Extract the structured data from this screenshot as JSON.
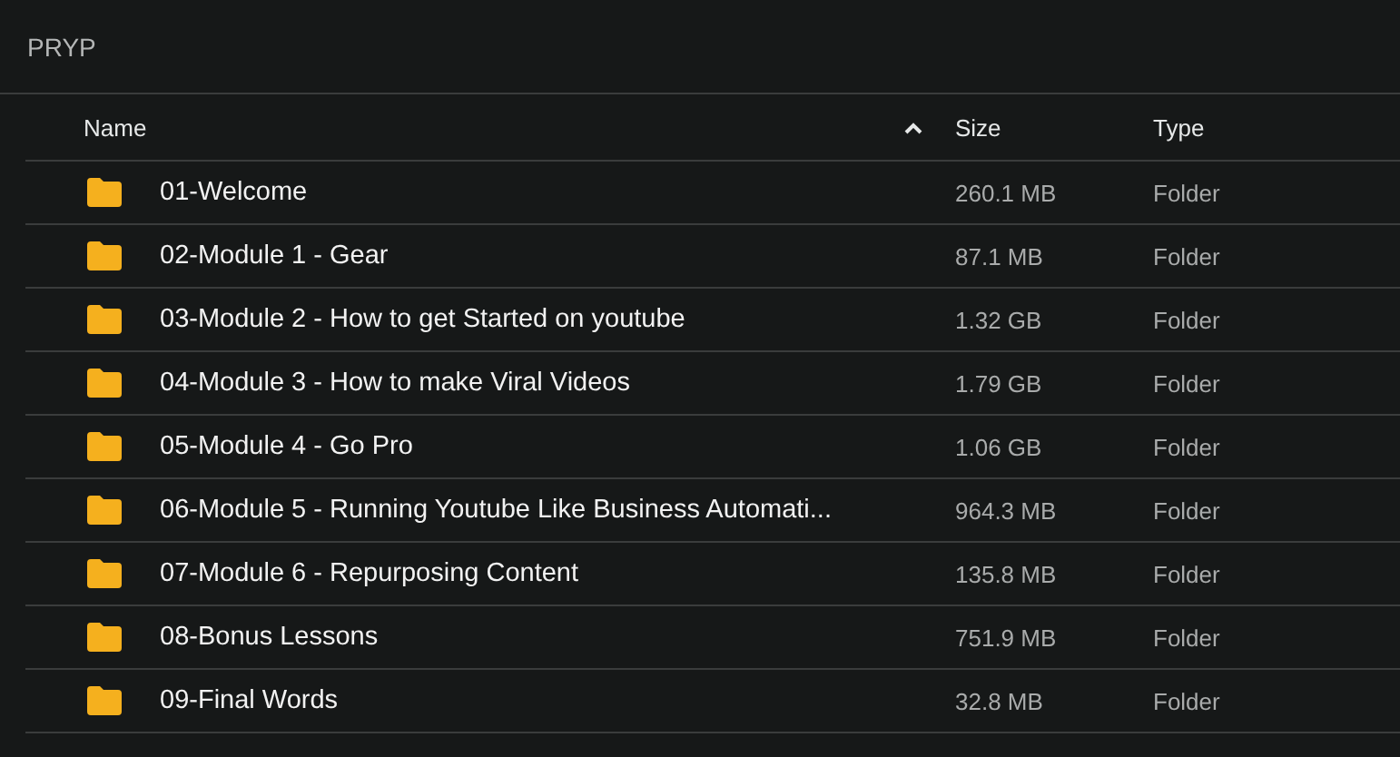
{
  "title": "PRYP",
  "columns": [
    {
      "label": "Name",
      "sorted_ascending": true
    },
    {
      "label": "Size"
    },
    {
      "label": "Type"
    }
  ],
  "rows": [
    {
      "name": "01-Welcome",
      "size": "260.1 MB",
      "type": "Folder"
    },
    {
      "name": "02-Module 1 - Gear",
      "size": "87.1 MB",
      "type": "Folder"
    },
    {
      "name": "03-Module 2 - How to get Started on youtube",
      "size": "1.32 GB",
      "type": "Folder"
    },
    {
      "name": "04-Module 3 - How to make Viral Videos",
      "size": "1.79 GB",
      "type": "Folder"
    },
    {
      "name": "05-Module 4 - Go Pro",
      "size": "1.06 GB",
      "type": "Folder"
    },
    {
      "name": "06-Module 5 - Running Youtube Like Business Automati...",
      "size": "964.3 MB",
      "type": "Folder"
    },
    {
      "name": "07-Module 6 - Repurposing Content",
      "size": "135.8 MB",
      "type": "Folder"
    },
    {
      "name": "08-Bonus Lessons",
      "size": "751.9 MB",
      "type": "Folder"
    },
    {
      "name": "09-Final Words",
      "size": "32.8 MB",
      "type": "Folder"
    }
  ]
}
